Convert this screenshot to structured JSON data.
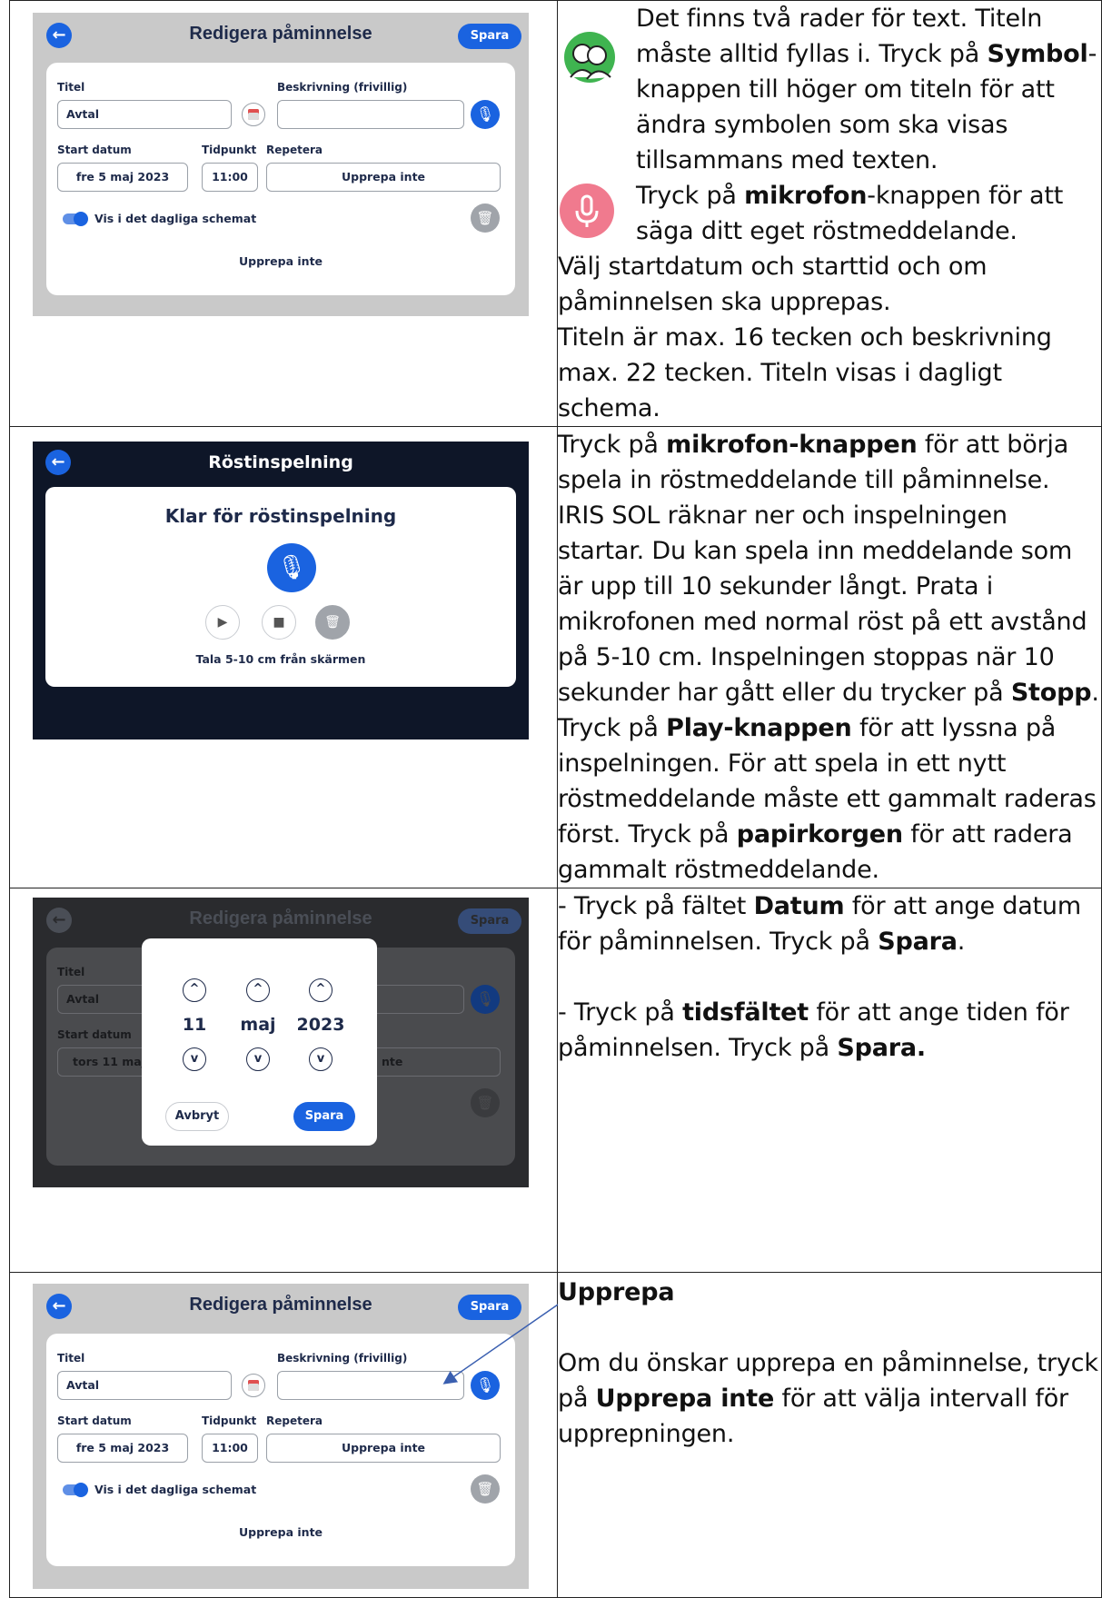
{
  "edit_screen": {
    "title": "Redigera påminnelse",
    "save_label": "Spara",
    "title_label": "Titel",
    "title_value": "Avtal",
    "description_label": "Beskrivning (frivillig)",
    "description_value": "",
    "start_date_label": "Start datum",
    "start_date_value": "fre 5 maj 2023",
    "time_label": "Tidpunkt",
    "time_value": "11:00",
    "repeat_label": "Repetera",
    "repeat_value": "Upprepa inte",
    "show_schedule_label": "Vis i det dagliga schemat",
    "repeat_summary": "Upprepa inte"
  },
  "recording_screen": {
    "title": "Röstinspelning",
    "heading": "Klar för röstinspelning",
    "hint": "Tala 5-10 cm från skärmen"
  },
  "date_picker_screen": {
    "title_value": "Avtal",
    "start_date_value": "tors 11 maj 2",
    "repeat_fragment": "nte",
    "day": "11",
    "month": "maj",
    "year": "2023",
    "cancel_label": "Avbryt",
    "save_label": "Spara"
  },
  "text": {
    "row1_a": "Det finns två rader för text. Titeln måste alltid fyllas i. Tryck på ",
    "row1_b": "Symbol",
    "row1_c": "-knappen till höger om titeln för att ändra symbolen som ska visas tillsammans med texten.",
    "row1_d": "Tryck på ",
    "row1_e": "mikrofon",
    "row1_f": "-knappen för att säga ditt eget röstmeddelande.",
    "row1_g": "Välj startdatum och starttid och om påminnelsen ska upprepas.",
    "row1_h": "Titeln är max. 16 tecken och beskrivning max. 22 tecken. Titeln visas i dagligt schema.",
    "row2_a": "Tryck på ",
    "row2_b": "mikrofon-knappen",
    "row2_c": " för att börja spela in röstmeddelande till påminnelse. IRIS SOL räknar ner och inspelningen startar. Du kan spela inn meddelande som är upp till 10 sekunder långt. Prata i mikrofonen med normal röst på ett avstånd på 5-10 cm. Inspelningen stoppas när 10 sekunder har gått eller du trycker på ",
    "row2_d": "Stopp",
    "row2_e": ".",
    "row2_f": "Tryck på ",
    "row2_g": "Play-knappen",
    "row2_h": " för att lyssna på inspelningen. För att spela in ett nytt röstmeddelande måste ett gammalt raderas först. Tryck på ",
    "row2_i": "papirkorgen",
    "row2_j": " för att radera gammalt röstmeddelande.",
    "row3_a": "- Tryck på fältet ",
    "row3_b": "Datum",
    "row3_c": " för att ange datum för påminnelsen. Tryck på ",
    "row3_d": "Spara",
    "row3_e": ".",
    "row3_f": "- Tryck på ",
    "row3_g": "tidsfältet",
    "row3_h": " för att ange tiden för påminnelsen. Tryck på ",
    "row3_i": "Spara.",
    "row4_heading": "Upprepa",
    "row4_a": "Om du önskar upprepa en påminnelse, tryck på ",
    "row4_b": "Upprepa inte",
    "row4_c": " för att välja intervall för upprepningen."
  }
}
